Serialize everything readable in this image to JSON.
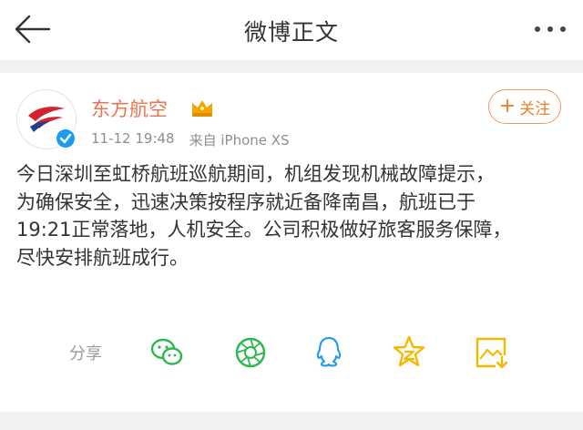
{
  "header": {
    "title": "微博正文",
    "back_icon": "back-arrow-icon",
    "more_icon": "more-dots-icon"
  },
  "post": {
    "author": "东方航空",
    "badge_icon": "crown-icon",
    "verified_icon": "verified-check-icon",
    "timestamp": "11-12 19:48",
    "source": "来自 iPhone XS",
    "follow_label": "关注",
    "follow_plus": "+",
    "text": "今日深圳至虹桥航班巡航期间，机组发现机械故障提示，\n为确保安全，迅速决策按程序就近备降南昌，航班已于\n19:21正常落地，人机安全。公司积极做好旅客服务保障，\n尽快安排航班成行。"
  },
  "share": {
    "label": "分享",
    "icons": [
      "wechat-icon",
      "moments-icon",
      "qq-icon",
      "qzone-icon",
      "save-image-icon"
    ]
  },
  "colors": {
    "accent": "#eb7350",
    "follow": "#f07f2a",
    "share_green": "#2db84d",
    "share_blue": "#2a9de8",
    "share_gold": "#f5b800"
  }
}
